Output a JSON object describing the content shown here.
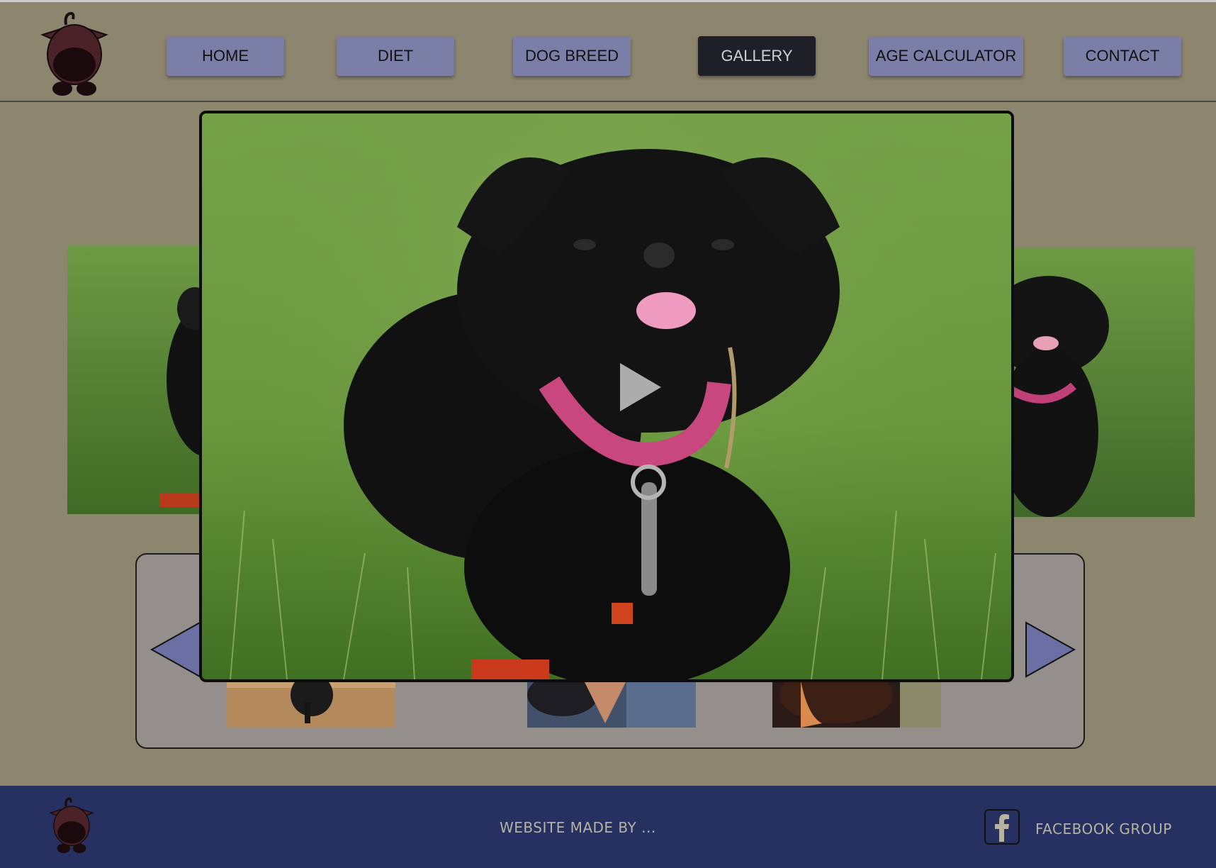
{
  "nav": {
    "items": [
      {
        "label": "HOME",
        "active": false
      },
      {
        "label": "DIET",
        "active": false
      },
      {
        "label": "DOG BREED",
        "active": false
      },
      {
        "label": "GALLERY",
        "active": true
      },
      {
        "label": "AGE CALCULATOR",
        "active": false
      },
      {
        "label": "CONTACT",
        "active": false
      }
    ]
  },
  "gallery": {
    "main_photo_icon": "play-icon",
    "prev_icon": "arrow-left-icon",
    "next_icon": "arrow-right-icon"
  },
  "footer": {
    "credit": "WEBSITE MADE BY ...",
    "facebook_label": "FACEBOOK GROUP",
    "facebook_icon": "facebook-icon"
  },
  "colors": {
    "page_bg": "#8d866e",
    "nav_button": "#7b7fa8",
    "nav_active": "#1f1f28",
    "footer_bg": "#263161"
  }
}
